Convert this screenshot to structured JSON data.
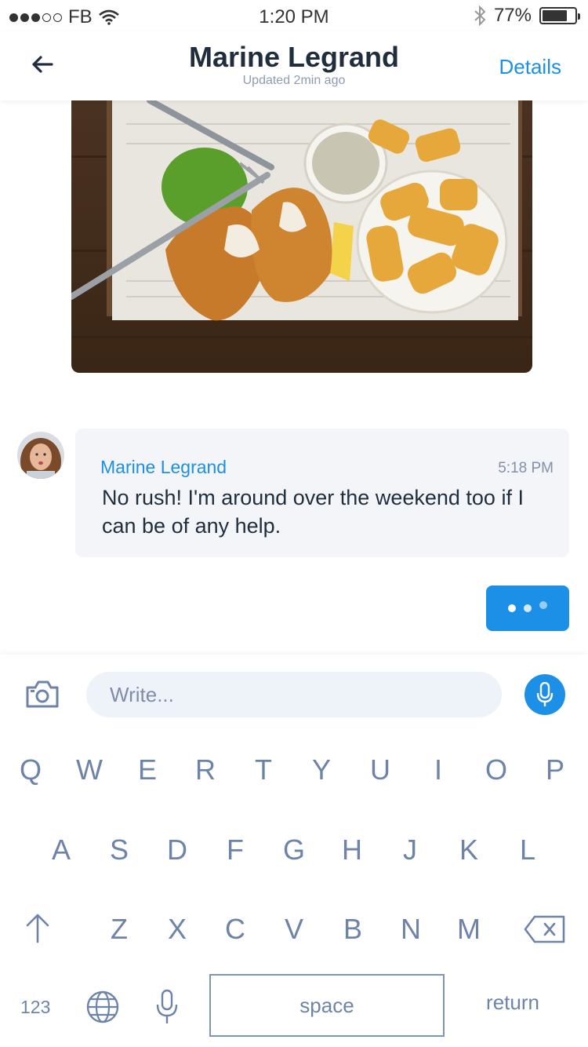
{
  "status_bar": {
    "carrier": "FB",
    "time": "1:20 PM",
    "battery": "77%",
    "battery_level": 0.77
  },
  "header": {
    "title": "Marine Legrand",
    "subtitle": "Updated 2min ago",
    "details_label": "Details"
  },
  "message": {
    "sender": "Marine Legrand",
    "time": "5:18 PM",
    "text": "No rush! I'm around over the weekend too if I can be of any help."
  },
  "composer": {
    "placeholder": "Write..."
  },
  "keyboard": {
    "row1": [
      "Q",
      "W",
      "E",
      "R",
      "T",
      "Y",
      "U",
      "I",
      "O",
      "P"
    ],
    "row2": [
      "A",
      "S",
      "D",
      "F",
      "G",
      "H",
      "J",
      "K",
      "L"
    ],
    "row3": [
      "Z",
      "X",
      "C",
      "V",
      "B",
      "N",
      "M"
    ],
    "numbers_label": "123",
    "space_label": "space",
    "return_label": "return"
  },
  "colors": {
    "accent": "#1c8fe6",
    "bubble": "#f3f5f8",
    "key_text": "#6d84a8"
  },
  "icons": [
    "back-arrow-icon",
    "wifi-icon",
    "bluetooth-icon",
    "camera-icon",
    "microphone-icon",
    "shift-icon",
    "backspace-icon",
    "globe-icon"
  ]
}
